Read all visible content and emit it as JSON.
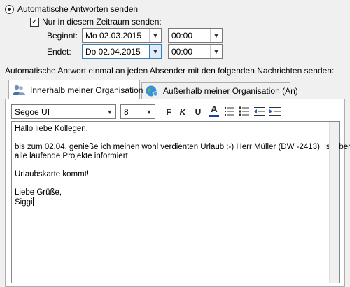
{
  "auto_reply": {
    "radio_label": "Automatische Antworten senden",
    "timeframe_checkbox_label": "Nur in diesem Zeitraum senden:",
    "timeframe_checked": true,
    "start": {
      "label": "Beginnt:",
      "date": "Mo 02.03.2015",
      "time": "00:00"
    },
    "end": {
      "label": "Endet:",
      "date": "Do 02.04.2015",
      "time": "00:00"
    },
    "instruction": "Automatische Antwort einmal an jeden Absender mit den folgenden Nachrichten senden:"
  },
  "tabs": [
    {
      "label": "Innerhalb meiner Organisation",
      "icon": "people-icon",
      "active": true
    },
    {
      "label": "Außerhalb meiner Organisation (An)",
      "icon": "globe-icon",
      "active": false
    }
  ],
  "toolbar": {
    "font": "Segoe UI",
    "size": "8",
    "bold": "F",
    "italic": "K",
    "underline": "U",
    "font_color": "A"
  },
  "message_lines": [
    "Hallo liebe Kollegen,",
    "",
    "bis zum 02.04. genieße ich meinen wohl verdienten Urlaub :-) Herr Müller (DW -2413)  ist über",
    "alle laufende Projekte informiert.",
    "",
    "Urlaubskarte kommt!",
    "",
    "Liebe Grüße,",
    "Siggi"
  ],
  "colors": {
    "background": "#f0f0f0",
    "font_color_bar": "#1f3f9f",
    "focus_blue": "#3c7fb1"
  }
}
